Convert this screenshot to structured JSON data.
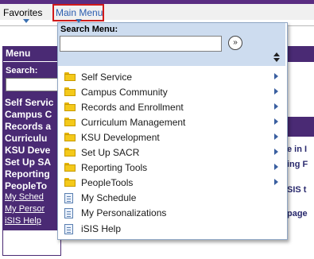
{
  "topbar": {
    "favorites_label": "Favorites",
    "main_menu_label": "Main Menu"
  },
  "left_menu": {
    "title": "Menu",
    "search_label": "Search:",
    "items": [
      "Self Servic",
      "Campus C",
      "Records a",
      "Curriculu",
      "KSU Deve",
      "Set Up SA",
      "Reporting",
      "PeopleTo"
    ],
    "links": [
      "My Sched",
      "My Persor",
      "iSIS Help"
    ]
  },
  "background_right": {
    "text_1": "e in I",
    "text_2": "ing F",
    "text_3": "SIS t",
    "text_4": "page"
  },
  "dropdown": {
    "search_label": "Search Menu:",
    "search_value": "",
    "go_glyph": "»",
    "items": [
      {
        "label": "Self Service",
        "icon": "folder-icon",
        "has_submenu": true
      },
      {
        "label": "Campus Community",
        "icon": "folder-icon",
        "has_submenu": true
      },
      {
        "label": "Records and Enrollment",
        "icon": "folder-icon",
        "has_submenu": true
      },
      {
        "label": "Curriculum Management",
        "icon": "folder-icon",
        "has_submenu": true
      },
      {
        "label": "KSU Development",
        "icon": "folder-icon",
        "has_submenu": true
      },
      {
        "label": "Set Up SACR",
        "icon": "folder-icon",
        "has_submenu": true
      },
      {
        "label": "Reporting Tools",
        "icon": "folder-icon",
        "has_submenu": true
      },
      {
        "label": "PeopleTools",
        "icon": "folder-icon",
        "has_submenu": true
      },
      {
        "label": "My Schedule",
        "icon": "document-icon",
        "has_submenu": false
      },
      {
        "label": "My Personalizations",
        "icon": "document-icon",
        "has_submenu": false
      },
      {
        "label": "iSIS Help",
        "icon": "document-icon",
        "has_submenu": false
      }
    ]
  },
  "colors": {
    "brand_purple": "#4a2a74",
    "search_panel": "#cddcef",
    "highlight_border": "#d11a1a",
    "link_blue": "#2a5db0"
  }
}
